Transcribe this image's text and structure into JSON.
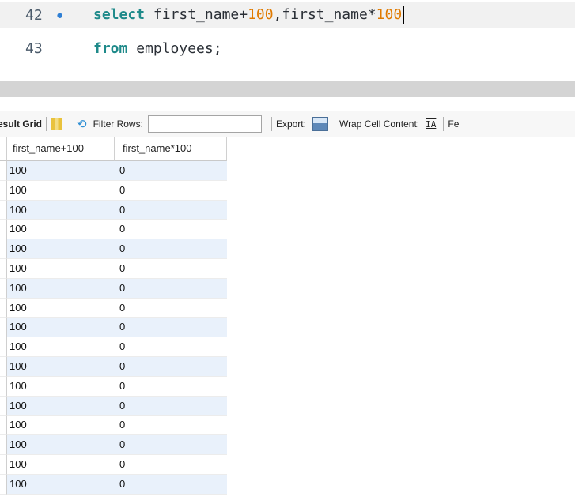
{
  "editor": {
    "lines": [
      {
        "num": "42",
        "kw": "select",
        "rest1": " first_name+",
        "n1": "100",
        "rest2": ",first_name*",
        "n2": "100"
      },
      {
        "num": "43",
        "kw": "from",
        "rest": " employees;"
      }
    ]
  },
  "toolbar": {
    "result_grid_label": "esult Grid",
    "filter_rows_label": "Filter Rows:",
    "filter_value": "",
    "export_label": "Export:",
    "wrap_label": "Wrap Cell Content:",
    "wrap_icon_glyph": "IA",
    "fetch_label": "Fe"
  },
  "grid": {
    "columns": [
      "first_name+100",
      "first_name*100"
    ],
    "rows": [
      [
        "100",
        "0"
      ],
      [
        "100",
        "0"
      ],
      [
        "100",
        "0"
      ],
      [
        "100",
        "0"
      ],
      [
        "100",
        "0"
      ],
      [
        "100",
        "0"
      ],
      [
        "100",
        "0"
      ],
      [
        "100",
        "0"
      ],
      [
        "100",
        "0"
      ],
      [
        "100",
        "0"
      ],
      [
        "100",
        "0"
      ],
      [
        "100",
        "0"
      ],
      [
        "100",
        "0"
      ],
      [
        "100",
        "0"
      ],
      [
        "100",
        "0"
      ],
      [
        "100",
        "0"
      ],
      [
        "100",
        "0"
      ]
    ]
  },
  "colors": {
    "keyword": "#1f8a8a",
    "number": "#e07a00",
    "row_alt": "#e9f1fb"
  }
}
